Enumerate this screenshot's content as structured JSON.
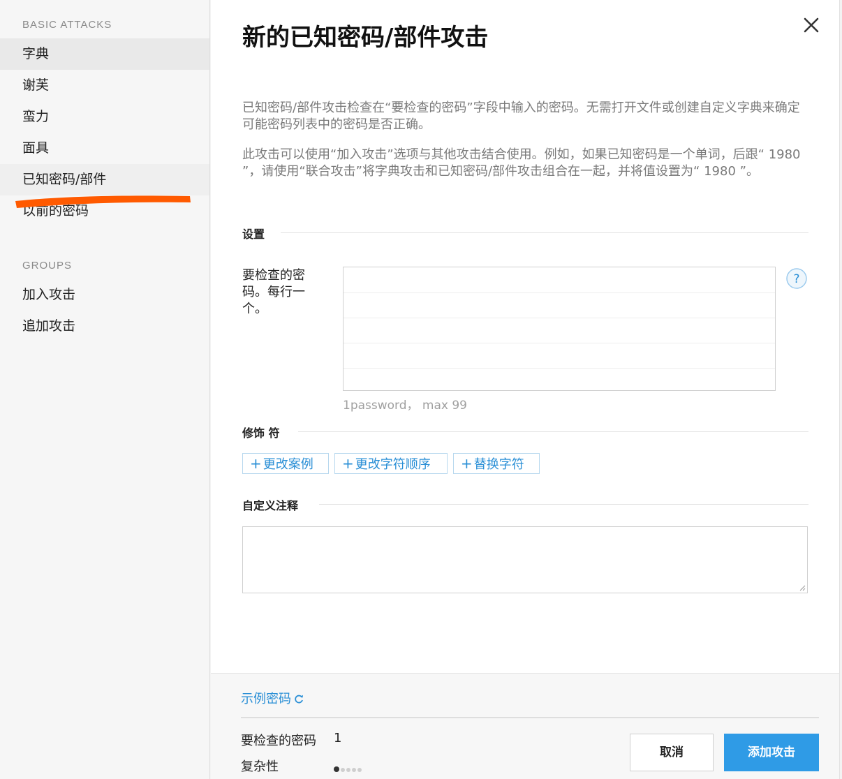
{
  "sidebar": {
    "basic_title": "BASIC ATTACKS",
    "basic_items": [
      {
        "label": "字典"
      },
      {
        "label": "谢芙"
      },
      {
        "label": "蛮力"
      },
      {
        "label": "面具"
      },
      {
        "label": "已知密码/部件"
      },
      {
        "label": "以前的密码"
      }
    ],
    "groups_title": "GROUPS",
    "group_items": [
      {
        "label": "加入攻击"
      },
      {
        "label": "追加攻击"
      }
    ],
    "annotation_color": "#ff5a00"
  },
  "dialog": {
    "title": "新的已知密码/部件攻击",
    "description_1": "已知密码/部件攻击检查在“要检查的密码”字段中输入的密码。无需打开文件或创建自定义字典来确定可能密码列表中的密码是否正确。",
    "description_2": "此攻击可以使用“加入攻击”选项与其他攻击结合使用。例如，如果已知密码是一个单词，后跟“ 1980 ”，请使用“联合攻击”将字典攻击和已知密码/部件攻击组合在一起，并将值设置为“ 1980 ”。",
    "settings": {
      "label": "设置",
      "passwords_field_label": "要检查的密码。每行一个。",
      "passwords_value": "",
      "hint": "1password， max 99",
      "help_glyph": "?"
    },
    "modifiers": {
      "label": "修饰 符",
      "buttons": [
        {
          "label": "更改案例"
        },
        {
          "label": "更改字符顺序"
        },
        {
          "label": "替换字符"
        }
      ],
      "plus_glyph": "+"
    },
    "comment": {
      "label": "自定义注释",
      "value": ""
    }
  },
  "footer": {
    "sample_link": "示例密码",
    "passwords_to_check_label": "要检查的密码",
    "passwords_to_check_value": "1",
    "complexity_label": "复杂性",
    "complexity_level": 1,
    "complexity_max": 5,
    "cancel_label": "取消",
    "add_label": "添加攻击"
  },
  "colors": {
    "accent": "#2f9be6",
    "link": "#2a8fd6"
  }
}
